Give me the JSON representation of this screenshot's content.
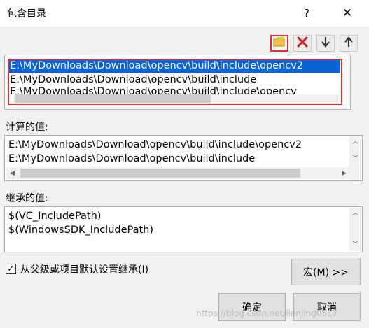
{
  "window": {
    "title": "包含目录",
    "help_label": "?",
    "close_label": "✕"
  },
  "toolbar": {
    "new_icon": "new-line-folder-icon",
    "delete_icon": "delete-x-icon",
    "down_icon": "move-down-arrow-icon",
    "up_icon": "move-up-arrow-icon",
    "accent_color": "#e03030"
  },
  "edit_list": {
    "lines": [
      "E:\\MyDownloads\\Download\\opencv\\build\\include\\opencv2",
      "E:\\MyDownloads\\Download\\opencv\\build\\include",
      "E:\\MyDownloads\\Download\\opencv\\build\\include\\opencv"
    ],
    "selected_index": 0,
    "selection_color": "#0a64d8"
  },
  "computed": {
    "label": "计算的值:",
    "lines": [
      "E:\\MyDownloads\\Download\\opencv\\build\\include\\opencv2",
      "E:\\MyDownloads\\Download\\opencv\\build\\include"
    ]
  },
  "inherited": {
    "label": "继承的值:",
    "lines": [
      "$(VC_IncludePath)",
      "$(WindowsSDK_IncludePath)"
    ]
  },
  "inherit_checkbox": {
    "label": "从父级或项目默认设置继承(I)",
    "checked": true,
    "check_glyph": "✓"
  },
  "buttons": {
    "macro": "宏(M) >>",
    "ok": "确定",
    "cancel": "取消"
  },
  "watermark": "https://blog.csdn.net/lianjing0517"
}
